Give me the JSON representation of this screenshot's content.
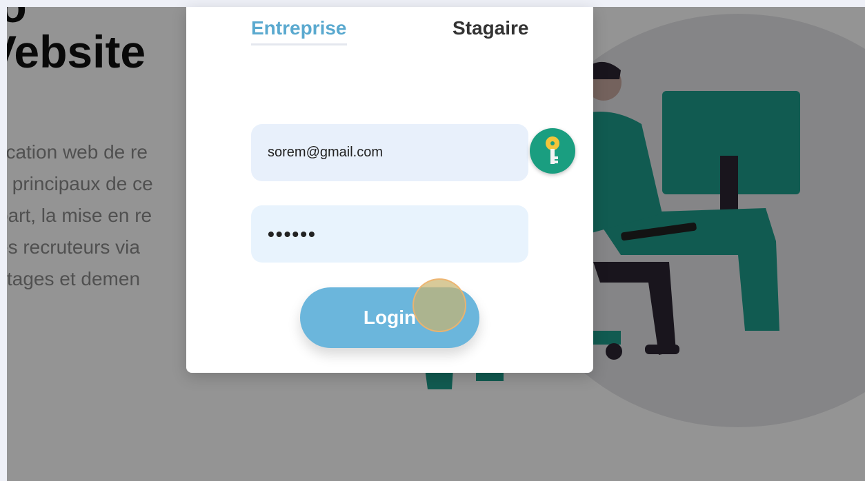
{
  "hero": {
    "title_line1": "lo",
    "title_line2": "Vebsite",
    "description_lines": [
      "lication web de re",
      "s principaux de ce",
      "part, la mise en re",
      "es recruteurs via",
      "stages et demen"
    ]
  },
  "login_modal": {
    "tabs": [
      {
        "label": "Entreprise",
        "active": true
      },
      {
        "label": "Stagaire",
        "active": false
      }
    ],
    "email_value": "sorem@gmail.com",
    "password_mask": "••••••",
    "key_icon": "key-icon",
    "login_label": "Login"
  },
  "colors": {
    "accent_tab": "#5aa9cf",
    "login_button": "#6bb6dc",
    "key_badge": "#1a9e80",
    "illustration_teal": "#1f9e8d"
  }
}
